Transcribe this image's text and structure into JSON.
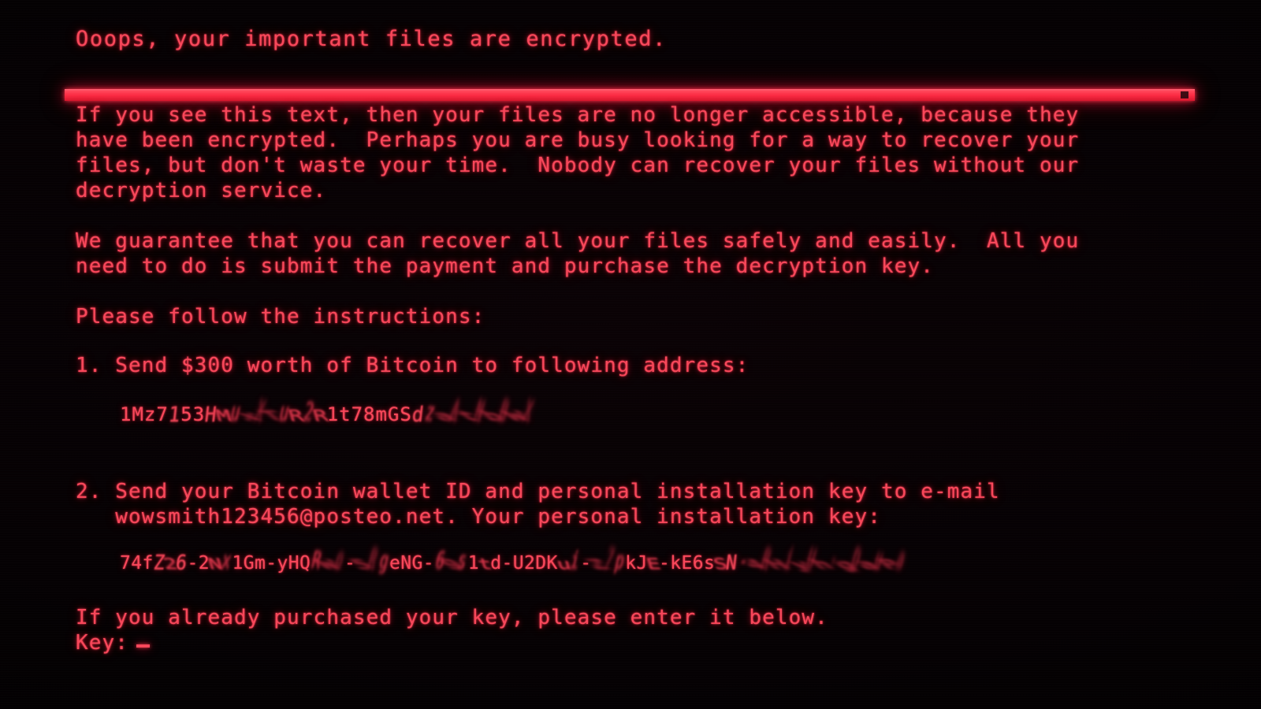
{
  "screen": {
    "kind": "ransomware-lock-screen",
    "background_color": "#000000",
    "text_color": "#f8475a",
    "rule_color": "#ff4256"
  },
  "headline": "Ooops, your important files are encrypted.",
  "intro": [
    "If you see this text, then your files are no longer accessible, because they",
    "have been encrypted.  Perhaps you are busy looking for a way to recover your",
    "files, but don't waste your time.  Nobody can recover your files without our",
    "decryption service."
  ],
  "guarantee": [
    "We guarantee that you can recover all your files safely and easily.  All you",
    "need to do is submit the payment and purchase the decryption key."
  ],
  "follow_instructions": "Please follow the instructions:",
  "step1": {
    "line": "1. Send $300 worth of Bitcoin to following address:",
    "bitcoin_address_readable": "1Mz7153HMuxXTuR2R1t78mGSdzaAtNbBWX",
    "bitcoin_address_note": "rendered corrupted/glitched on screen"
  },
  "step2": {
    "lines": [
      "2. Send your Bitcoin wallet ID and personal installation key to e-mail",
      "   wowsmith123456@posteo.net. Your personal installation key:"
    ],
    "email": "wowsmith123456@posteo.net",
    "installation_key_readable": "74fZ26-2Nx1Gm-yHQRWo-5RgeNG-69s1td-U2DKui-Z7pkJE-kE6sSN-4RHiyUh-gDauPa",
    "installation_key_note": "rendered corrupted/glitched on screen"
  },
  "closing": {
    "prompt_line": "If you already purchased your key, please enter it below.",
    "key_label": "Key:",
    "key_value": ""
  }
}
